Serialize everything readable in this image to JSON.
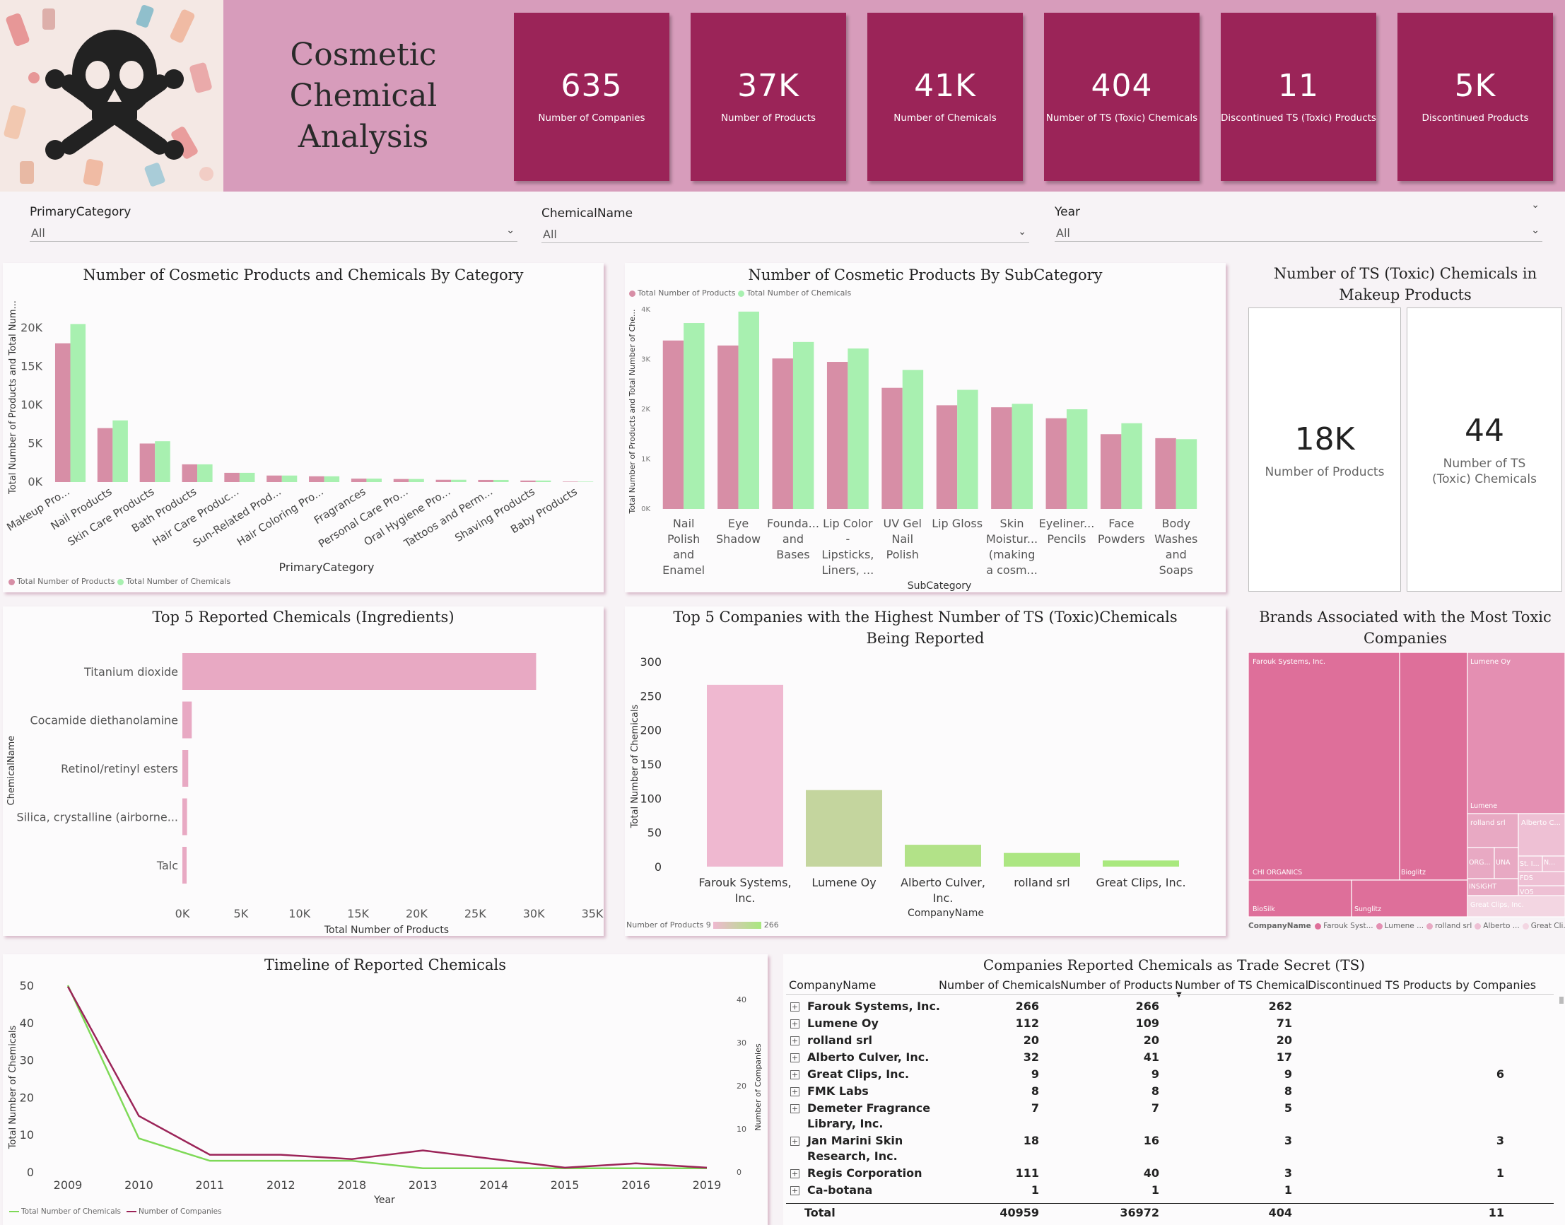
{
  "header": {
    "title_line1": "Cosmetic Chemical",
    "title_line2": "Analysis"
  },
  "kpis": [
    {
      "value": "635",
      "label": "Number of Companies"
    },
    {
      "value": "37K",
      "label": "Number of Products"
    },
    {
      "value": "41K",
      "label": "Number of Chemicals"
    },
    {
      "value": "404",
      "label": "Number of TS (Toxic) Chemicals"
    },
    {
      "value": "11",
      "label": "Discontinued TS (Toxic) Products"
    },
    {
      "value": "5K",
      "label": "Discontinued Products"
    }
  ],
  "filters": [
    {
      "title": "PrimaryCategory",
      "value": "All"
    },
    {
      "title": "ChemicalName",
      "value": "All"
    },
    {
      "title": "Year",
      "value": "All"
    }
  ],
  "colors": {
    "pink": "#d78ea6",
    "green": "#a8f0b0",
    "maroon": "#9b2458",
    "banner": "#d79cbb"
  },
  "icons": {
    "logo": "skull-crossbones-icon",
    "dropdown": "chevron-down-icon",
    "expand": "plus-box-icon",
    "sort": "sort-desc-icon"
  },
  "chart_data": [
    {
      "id": "category",
      "type": "bar",
      "title": "Number of Cosmetic Products and Chemicals By Category",
      "xlabel": "PrimaryCategory",
      "ylabel": "Total Number of Products and Total Num...",
      "categories": [
        "Makeup Pro...",
        "Nail Products",
        "Skin Care Products",
        "Bath Products",
        "Hair Care Produc...",
        "Sun-Related Prod...",
        "Hair Coloring Pro...",
        "Fragrances",
        "Personal Care Pro...",
        "Oral Hygiene Pro...",
        "Tattoos and Perm...",
        "Shaving Products",
        "Baby Products"
      ],
      "ticks": [
        "0K",
        "5K",
        "10K",
        "15K",
        "20K"
      ],
      "ylim": [
        0,
        22000
      ],
      "series": [
        {
          "name": "Total Number of Products",
          "values": [
            18000,
            7000,
            5000,
            2300,
            1200,
            850,
            750,
            450,
            400,
            300,
            280,
            200,
            60
          ]
        },
        {
          "name": "Total Number of Chemicals",
          "values": [
            20500,
            8000,
            5300,
            2300,
            1200,
            850,
            750,
            450,
            400,
            300,
            280,
            200,
            60
          ]
        }
      ]
    },
    {
      "id": "subcategory",
      "type": "bar",
      "title": "Number of Cosmetic Products By SubCategory",
      "xlabel": "SubCategory",
      "ylabel": "Total Number of Products and Total Number of Che...",
      "categories": [
        [
          "Nail",
          "Polish",
          "and",
          "Enamel"
        ],
        [
          "Eye",
          "Shadow"
        ],
        [
          "Founda...",
          "and",
          "Bases"
        ],
        [
          "Lip Color",
          "-",
          "Lipsticks,",
          "Liners, ..."
        ],
        [
          "UV Gel",
          "Nail",
          "Polish"
        ],
        [
          "Lip Gloss"
        ],
        [
          "Skin",
          "Moistur...",
          "(making",
          "a cosm..."
        ],
        [
          "Eyeliner...",
          "Pencils"
        ],
        [
          "Face",
          "Powders"
        ],
        [
          "Body",
          "Washes",
          "and",
          "Soaps"
        ]
      ],
      "ticks": [
        "0K",
        "1K",
        "2K",
        "3K",
        "4K"
      ],
      "ylim": [
        0,
        4000
      ],
      "series": [
        {
          "name": "Total Number of Products",
          "values": [
            3380,
            3280,
            3020,
            2950,
            2430,
            2080,
            2040,
            1820,
            1500,
            1420
          ]
        },
        {
          "name": "Total Number of Chemicals",
          "values": [
            3730,
            3960,
            3350,
            3220,
            2790,
            2390,
            2110,
            2000,
            1720,
            1400
          ]
        }
      ]
    },
    {
      "id": "makeup",
      "type": "table",
      "title": "Number of TS (Toxic) Chemicals in Makeup Products",
      "cards": [
        {
          "value": "18K",
          "label": "Number of Products"
        },
        {
          "value": "44",
          "label": "Number of TS (Toxic) Chemicals"
        }
      ]
    },
    {
      "id": "top5chem",
      "type": "bar",
      "title": "Top 5 Reported Chemicals (Ingredients)",
      "xlabel": "Total Number of Products",
      "ylabel": "ChemicalName",
      "categories": [
        "Titanium dioxide",
        "Cocamide diethanolamine",
        "Retinol/retinyl esters",
        "Silica, crystalline (airborne...",
        "Talc"
      ],
      "values": [
        30200,
        800,
        500,
        400,
        300
      ],
      "ticks": [
        "0K",
        "5K",
        "10K",
        "15K",
        "20K",
        "25K",
        "30K",
        "35K"
      ],
      "xlim": [
        0,
        35000
      ]
    },
    {
      "id": "top5comp",
      "type": "bar",
      "title": "Top 5 Companies with the Highest Number of TS (Toxic)Chemicals Being Reported",
      "xlabel": "CompanyName",
      "ylabel": "Total Number of Chemicals",
      "categories": [
        [
          "Farouk Systems,",
          "Inc."
        ],
        [
          "Lumene Oy"
        ],
        [
          "Alberto Culver,",
          "Inc."
        ],
        [
          "rolland srl"
        ],
        [
          "Great Clips, Inc."
        ]
      ],
      "values": [
        266,
        112,
        32,
        20,
        9
      ],
      "color_values": [
        266,
        109,
        41,
        20,
        9
      ],
      "ticks": [
        "0",
        "50",
        "100",
        "150",
        "200",
        "250",
        "300"
      ],
      "ylim": [
        0,
        300
      ],
      "legend_title": "Number of Products",
      "legend_min": "9",
      "legend_max": "266"
    },
    {
      "id": "treemap",
      "type": "heatmap",
      "title": "Brands Associated with the Most Toxic Companies",
      "legend_title": "CompanyName",
      "legend": [
        "Farouk Syst...",
        "Lumene ...",
        "rolland srl",
        "Alberto ...",
        "Great Cli..."
      ],
      "labels": {
        "farouk": "Farouk Systems, Inc.",
        "lumene": "Lumene Oy",
        "chi": "CHI ORGANICS",
        "bioglitz": "Bioglitz",
        "biosilk": "BioSilk",
        "sunglitz": "Sunglitz",
        "lumene_brand": "Lumene",
        "rolland": "rolland srl",
        "alberto": "Alberto C...",
        "org": "ORG...",
        "una": "UNA",
        "insight": "INSIGHT",
        "st": "St. I...",
        "n": "N...",
        "fds": "FDS",
        "vo5": "VO5",
        "great": "Great Clips, Inc."
      }
    },
    {
      "id": "timeline",
      "type": "line",
      "title": "Timeline of Reported Chemicals",
      "xlabel": "Year",
      "ylabel": "Total Number of Chemicals",
      "y2label": "Number of Companies",
      "x": [
        "2009",
        "2010",
        "2011",
        "2012",
        "2018",
        "2013",
        "2014",
        "2015",
        "2016",
        "2019"
      ],
      "yticks": [
        "0",
        "10",
        "20",
        "30",
        "40",
        "50"
      ],
      "y2ticks": [
        "0",
        "10",
        "20",
        "30",
        "40"
      ],
      "series": [
        {
          "name": "Total Number of Chemicals",
          "axis": "left",
          "values": [
            50,
            9,
            3,
            3,
            3,
            1,
            1,
            1,
            1,
            1
          ]
        },
        {
          "name": "Number of Companies",
          "axis": "right",
          "values": [
            43,
            13,
            4,
            4,
            3,
            5,
            3,
            1,
            2,
            1
          ]
        }
      ]
    }
  ],
  "ts_table": {
    "title": "Companies Reported Chemicals as Trade Secret (TS)",
    "headers": [
      "CompanyName",
      "Number of Chemicals",
      "Number of Products",
      "Number of TS Chemical",
      "Discontinued TS Products by Companies"
    ],
    "rows": [
      {
        "name1": "Farouk Systems, Inc.",
        "name2": "",
        "chem": "266",
        "prod": "266",
        "ts": "262",
        "disc": ""
      },
      {
        "name1": "Lumene Oy",
        "name2": "",
        "chem": "112",
        "prod": "109",
        "ts": "71",
        "disc": ""
      },
      {
        "name1": "rolland srl",
        "name2": "",
        "chem": "20",
        "prod": "20",
        "ts": "20",
        "disc": ""
      },
      {
        "name1": "Alberto Culver, Inc.",
        "name2": "",
        "chem": "32",
        "prod": "41",
        "ts": "17",
        "disc": ""
      },
      {
        "name1": "Great Clips, Inc.",
        "name2": "",
        "chem": "9",
        "prod": "9",
        "ts": "9",
        "disc": "6"
      },
      {
        "name1": "FMK Labs",
        "name2": "",
        "chem": "8",
        "prod": "8",
        "ts": "8",
        "disc": ""
      },
      {
        "name1": "Demeter Fragrance",
        "name2": "Library, Inc.",
        "chem": "7",
        "prod": "7",
        "ts": "5",
        "disc": ""
      },
      {
        "name1": "Jan Marini Skin",
        "name2": "Research, Inc.",
        "chem": "18",
        "prod": "16",
        "ts": "3",
        "disc": "3"
      },
      {
        "name1": "Regis Corporation",
        "name2": "",
        "chem": "111",
        "prod": "40",
        "ts": "3",
        "disc": "1"
      },
      {
        "name1": "Ca-botana",
        "name2": "",
        "chem": "1",
        "prod": "1",
        "ts": "1",
        "disc": ""
      }
    ],
    "total": {
      "label": "Total",
      "chem": "40959",
      "prod": "36972",
      "ts": "404",
      "disc": "11"
    }
  }
}
